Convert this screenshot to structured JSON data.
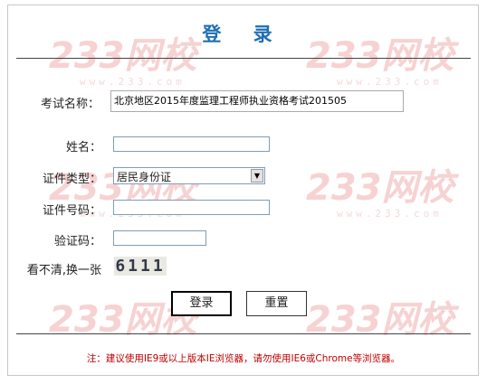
{
  "title": "登 录",
  "watermark": {
    "brand": "233网校",
    "sub": "www.233.com"
  },
  "form": {
    "exam_label": "考试名称：",
    "exam_value": "北京地区2015年度监理工程师执业资格考试201505",
    "name_label": "姓名：",
    "name_value": "",
    "idtype_label": "证件类型：",
    "idtype_value": "居民身份证",
    "idnum_label": "证件号码：",
    "idnum_value": "",
    "code_label": "验证码：",
    "code_value": "",
    "refresh_label": "看不清,换一张",
    "captcha_text": "6111"
  },
  "buttons": {
    "login": "登录",
    "reset": "重置"
  },
  "note": "注：建议使用IE9或以上版本IE浏览器，请勿使用IE6或Chrome等浏览器。"
}
